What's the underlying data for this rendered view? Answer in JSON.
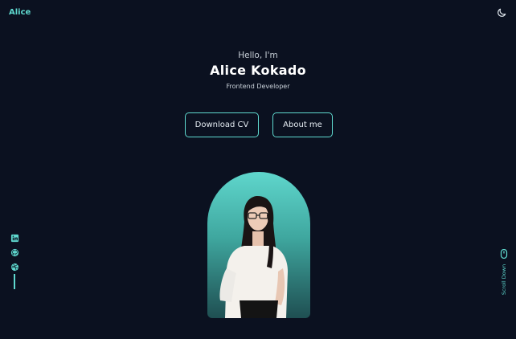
{
  "header": {
    "logo": "Alice",
    "theme_toggle_icon": "moon-icon"
  },
  "hero": {
    "greeting": "Hello, I'm",
    "name": "Alice Kokado",
    "role": "Frontend Developer",
    "download_cv_label": "Download CV",
    "about_label": "About me"
  },
  "social": {
    "items": [
      {
        "icon": "linkedin-icon"
      },
      {
        "icon": "github-icon"
      },
      {
        "icon": "dribbble-icon"
      }
    ]
  },
  "scroll": {
    "label": "Scroll Down",
    "icon": "mouse-icon"
  },
  "colors": {
    "background": "#0b1120",
    "accent": "#5fd9cf",
    "text": "#e6edf3"
  }
}
